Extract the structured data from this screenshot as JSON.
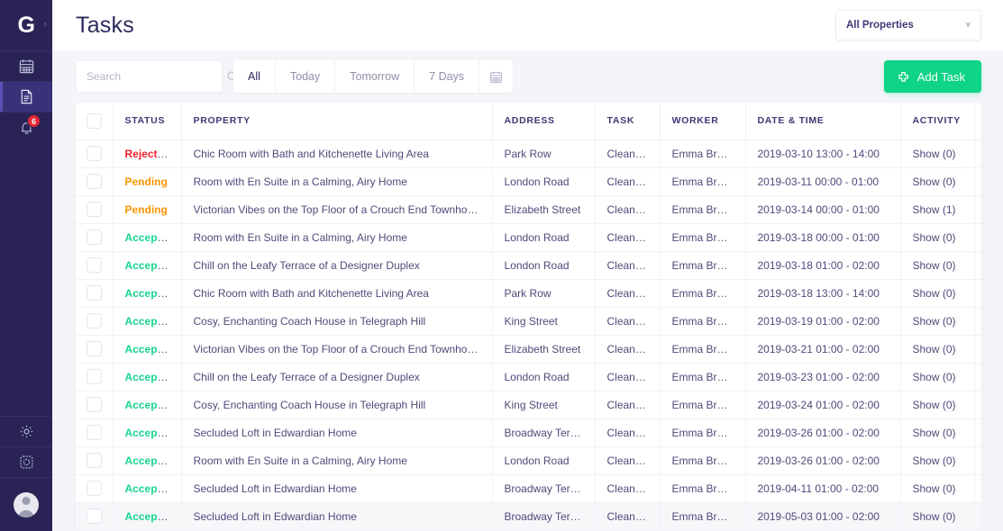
{
  "sidebar": {
    "logo": "G",
    "expand_icon": "chevron-right-icon",
    "items": [
      {
        "icon": "calendar-icon",
        "active": false,
        "badge": null
      },
      {
        "icon": "document-list-icon",
        "active": true,
        "badge": null
      },
      {
        "icon": "bell-icon",
        "active": false,
        "badge": "6"
      }
    ],
    "bottom_items": [
      {
        "icon": "gear-icon",
        "active": false
      },
      {
        "icon": "gear-dashed-icon",
        "active": false
      }
    ],
    "avatar": "user-avatar"
  },
  "header": {
    "title": "Tasks",
    "property_filter": {
      "label": "All Properties",
      "icon": "chevron-down-icon"
    }
  },
  "toolbar": {
    "search": {
      "placeholder": "Search",
      "value": "",
      "icon": "search-icon"
    },
    "filters": [
      {
        "label": "All",
        "active": true
      },
      {
        "label": "Today",
        "active": false
      },
      {
        "label": "Tomorrow",
        "active": false
      },
      {
        "label": "7 Days",
        "active": false
      }
    ],
    "calendar_button": "calendar-icon",
    "add_task": {
      "label": "Add Task",
      "icon": "plus-icon",
      "color": "#0fd487"
    }
  },
  "table": {
    "columns": [
      "STATUS",
      "PROPERTY",
      "ADDRESS",
      "TASK",
      "WORKER",
      "DATE & TIME",
      "ACTIVITY"
    ],
    "select_all": "select-all-checkbox",
    "status_colors": {
      "Rejected": "#f5222d",
      "Pending": "#fa9600",
      "Accepted": "#17d68d"
    },
    "rows": [
      {
        "status": "Rejected",
        "property": "Chic Room with Bath and Kitchenette Living Area",
        "address": "Park Row",
        "task": "Cleaning",
        "worker": "Emma Brown",
        "datetime": "2019-03-10 13:00 - 14:00",
        "activity": "Show (0)",
        "hovered": false
      },
      {
        "status": "Pending",
        "property": "Room with En Suite in a Calming, Airy Home",
        "address": "London Road",
        "task": "Cleaning",
        "worker": "Emma Brown",
        "datetime": "2019-03-11 00:00 - 01:00",
        "activity": "Show (0)",
        "hovered": false
      },
      {
        "status": "Pending",
        "property": "Victorian Vibes on the Top Floor of a Crouch End Townhouse",
        "address": "Elizabeth Street",
        "task": "Cleaning",
        "worker": "Emma Brown",
        "datetime": "2019-03-14 00:00 - 01:00",
        "activity": "Show (1)",
        "hovered": false
      },
      {
        "status": "Accepted",
        "property": "Room with En Suite in a Calming, Airy Home",
        "address": "London Road",
        "task": "Cleaning",
        "worker": "Emma Brown",
        "datetime": "2019-03-18 00:00 - 01:00",
        "activity": "Show (0)",
        "hovered": false
      },
      {
        "status": "Accepted",
        "property": "Chill on the Leafy Terrace of a Designer Duplex",
        "address": "London Road",
        "task": "Cleaning",
        "worker": "Emma Brown",
        "datetime": "2019-03-18 01:00 - 02:00",
        "activity": "Show (0)",
        "hovered": false
      },
      {
        "status": "Accepted",
        "property": "Chic Room with Bath and Kitchenette Living Area",
        "address": "Park Row",
        "task": "Cleaning",
        "worker": "Emma Brown",
        "datetime": "2019-03-18 13:00 - 14:00",
        "activity": "Show (0)",
        "hovered": false
      },
      {
        "status": "Accepted",
        "property": "Cosy, Enchanting Coach House in Telegraph Hill",
        "address": "King Street",
        "task": "Cleaning",
        "worker": "Emma Brown",
        "datetime": "2019-03-19 01:00 - 02:00",
        "activity": "Show (0)",
        "hovered": false
      },
      {
        "status": "Accepted",
        "property": "Victorian Vibes on the Top Floor of a Crouch End Townhouse",
        "address": "Elizabeth Street",
        "task": "Cleaning",
        "worker": "Emma Brown",
        "datetime": "2019-03-21 01:00 - 02:00",
        "activity": "Show (0)",
        "hovered": false
      },
      {
        "status": "Accepted",
        "property": "Chill on the Leafy Terrace of a Designer Duplex",
        "address": "London Road",
        "task": "Cleaning",
        "worker": "Emma Brown",
        "datetime": "2019-03-23 01:00 - 02:00",
        "activity": "Show (0)",
        "hovered": false
      },
      {
        "status": "Accepted",
        "property": "Cosy, Enchanting Coach House in Telegraph Hill",
        "address": "King Street",
        "task": "Cleaning",
        "worker": "Emma Brown",
        "datetime": "2019-03-24 01:00 - 02:00",
        "activity": "Show (0)",
        "hovered": false
      },
      {
        "status": "Accepted",
        "property": "Secluded Loft in Edwardian Home",
        "address": "Broadway Terrace",
        "task": "Cleaning",
        "worker": "Emma Brown",
        "datetime": "2019-03-26 01:00 - 02:00",
        "activity": "Show (0)",
        "hovered": false
      },
      {
        "status": "Accepted",
        "property": "Room with En Suite in a Calming, Airy Home",
        "address": "London Road",
        "task": "Cleaning",
        "worker": "Emma Brown",
        "datetime": "2019-03-26 01:00 - 02:00",
        "activity": "Show (0)",
        "hovered": false
      },
      {
        "status": "Accepted",
        "property": "Secluded Loft in Edwardian Home",
        "address": "Broadway Terrace",
        "task": "Cleaning",
        "worker": "Emma Brown",
        "datetime": "2019-04-11 01:00 - 02:00",
        "activity": "Show (0)",
        "hovered": false
      },
      {
        "status": "Accepted",
        "property": "Secluded Loft in Edwardian Home",
        "address": "Broadway Terrace",
        "task": "Cleaning",
        "worker": "Emma Brown",
        "datetime": "2019-05-03 01:00 - 02:00",
        "activity": "Show (0)",
        "hovered": true
      }
    ]
  }
}
